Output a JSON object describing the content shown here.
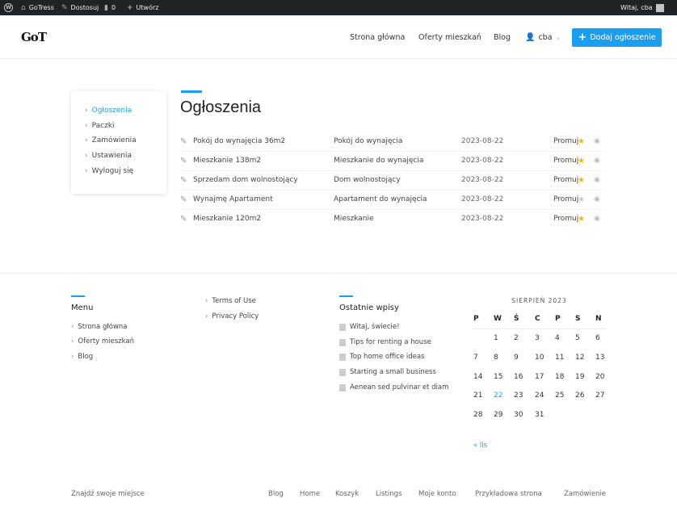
{
  "adminbar": {
    "site": "GoTress",
    "customize": "Dostosuj",
    "comments": "0",
    "new": "Utwórz",
    "greeting": "Witaj, cba"
  },
  "header": {
    "logo": "GoT",
    "nav": [
      "Strona główna",
      "Oferty mieszkań",
      "Blog"
    ],
    "user": "cba",
    "add_button": "Dodaj ogłoszenie"
  },
  "sidebar": {
    "items": [
      "Ogłoszenia",
      "Paczki",
      "Zamówienia",
      "Ustawienia",
      "Wyloguj się"
    ]
  },
  "main": {
    "title": "Ogłoszenia",
    "rows": [
      {
        "title": "Pokój do wynajęcia 36m2",
        "category": "Pokój do wynajęcia",
        "date": "2023-08-22",
        "action": "Promuj",
        "featured": true
      },
      {
        "title": "Mieszkanie 138m2",
        "category": "Mieszkanie do wynajęcia",
        "date": "2023-08-22",
        "action": "Promuj",
        "featured": true
      },
      {
        "title": "Sprzedam dom wolnostojący",
        "category": "Dom wolnostojący",
        "date": "2023-08-22",
        "action": "Promuj",
        "featured": true
      },
      {
        "title": "Wynajmę Apartament",
        "category": "Apartament do wynajęcia",
        "date": "2023-08-22",
        "action": "Promuj",
        "featured": false
      },
      {
        "title": "Mieszkanie 120m2",
        "category": "Mieszkanie",
        "date": "2023-08-22",
        "action": "Promuj",
        "featured": true
      }
    ]
  },
  "footer": {
    "menu_title": "Menu",
    "menu": [
      "Strona główna",
      "Oferty mieszkań",
      "Blog"
    ],
    "links": [
      "Terms of Use",
      "Privacy Policy"
    ],
    "recent_title": "Ostatnie wpisy",
    "recent": [
      "Witaj, świecie!",
      "Tips for renting a house",
      "Top home office ideas",
      "Starting a small business",
      "Aenean sed pulvinar et diam"
    ],
    "calendar": {
      "caption": "SIERPIEŃ 2023",
      "days": [
        "P",
        "W",
        "Ś",
        "C",
        "P",
        "S",
        "N"
      ],
      "weeks": [
        [
          "",
          "1",
          "2",
          "3",
          "4",
          "5",
          "6"
        ],
        [
          "7",
          "8",
          "9",
          "10",
          "11",
          "12",
          "13"
        ],
        [
          "14",
          "15",
          "16",
          "17",
          "18",
          "19",
          "20"
        ],
        [
          "21",
          "22",
          "23",
          "24",
          "25",
          "26",
          "27"
        ],
        [
          "28",
          "29",
          "30",
          "31",
          "",
          "",
          ""
        ]
      ],
      "highlight": "22",
      "prev": "« lis"
    },
    "tagline": "Znajdź swoje miejsce",
    "bottom_links": [
      "Blog",
      "Home",
      "Koszyk",
      "Listings",
      "Moje konto",
      "Przykładowa strona",
      "Zamówienie"
    ]
  },
  "colors": {
    "accent": "#1a9ff0",
    "star_on": "#f5b800",
    "star_off": "#c8c8c8",
    "adminbar": "#1d2327"
  }
}
